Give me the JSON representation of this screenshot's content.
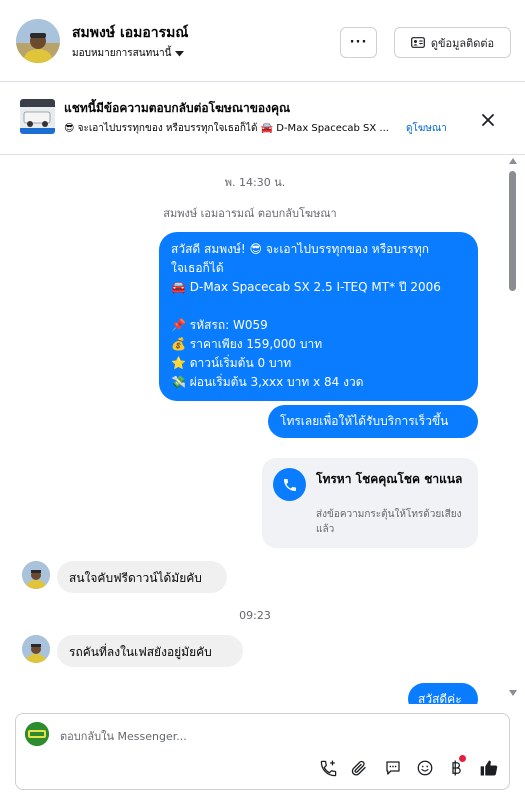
{
  "header": {
    "contact_name": "สมพงษ์ เอมอารมณ์",
    "assign_label": "มอบหมายการสนทนานี้",
    "more_label": "···",
    "contact_info_label": "ดูข้อมูลติดต่อ"
  },
  "ad_banner": {
    "title": "แชทนี้มีข้อความตอบกลับต่อโฆษณาของคุณ",
    "subtitle": "😎 จะเอาไปบรรทุกของ หรือบรรทุกใจเธอก็ได้ 🚘 D-Max Spacecab SX ...",
    "view_ad_label": "ดูโฆษณา"
  },
  "thread": {
    "timestamp_1": "พ. 14:30 น.",
    "ad_reply_note": "สมพงษ์ เอมอารมณ์ ตอบกลับโฆษณา",
    "ad_message_lines": [
      "สวัสดี สมพงษ์! 😎 จะเอาไปบรรทุกของ หรือบรรทุก",
      "ใจเธอก็ได้",
      "🚘 D-Max Spacecab SX 2.5 I-TEQ MT* ปี 2006",
      "",
      "📌 รหัสรถ: W059",
      "💰 ราคาเพียง 159,000 บาท",
      "⭐ ดาวน์เริ่มต้น 0 บาท",
      "💸 ผ่อนเริ่มต้น 3,xxx บาท x 84 งวด"
    ],
    "cta_message": "โทรเลยเพื่อให้ได้รับบริการเร็วขึ้น",
    "call_card": {
      "title": "โทรหา โชคคุณโชค ชาแนล",
      "subtitle": "ส่งข้อความกระตุ้นให้โทรด้วยเสียงแล้ว"
    },
    "incoming_1": "สนใจคับฟรีดาวน์ได้มัยคับ",
    "timestamp_2": "09:23",
    "incoming_2": "รถคันที่ลงในเฟสยังอยู่มัยคับ",
    "outgoing_partial": "สวัสดีค่ะ"
  },
  "composer": {
    "placeholder": "ตอบกลับใน Messenger..."
  },
  "colors": {
    "bubble_out": "#0a7cff",
    "bubble_in": "#f0f0f0",
    "link": "#0064d1",
    "like_icon": "#1c1e21",
    "notification_dot": "#e41e3f"
  }
}
